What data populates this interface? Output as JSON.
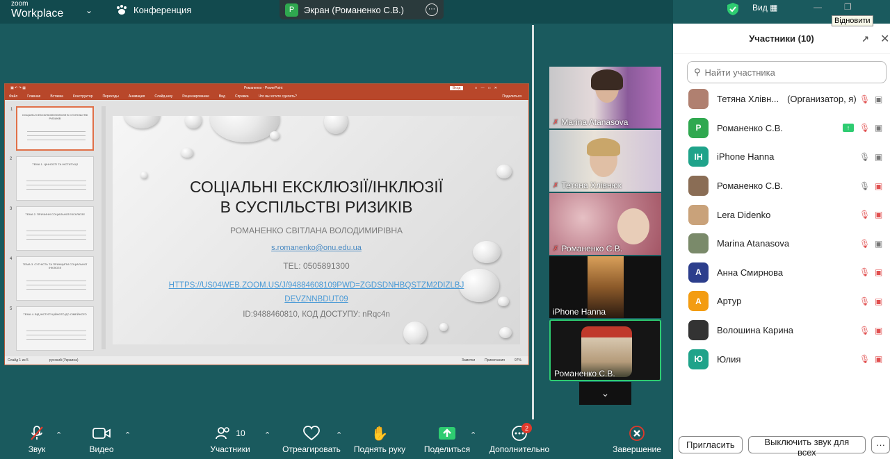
{
  "app": {
    "brand_top": "zoom",
    "brand_bottom": "Workplace",
    "meeting_label": "Конференция"
  },
  "screen_share": {
    "badge": "P",
    "label": "Экран (Романенко С.В.)"
  },
  "header_right": {
    "view_label": "Вид",
    "tooltip": "Відновити"
  },
  "slide": {
    "window_title": "Романенко - PowerPoint",
    "menu": [
      "Файл",
      "Главная",
      "Вставка",
      "Конструктор",
      "Переходы",
      "Анимация",
      "Слайд-шоу",
      "Рецензирование",
      "Вид",
      "Справка",
      "Что вы хотите сделать?"
    ],
    "share_btn": "Поделиться",
    "login_btn": "Вход",
    "title_line1": "СОЦІАЛЬНІ ЕКСКЛЮЗІЇ/ІНКЛЮЗІЇ",
    "title_line2": "В СУСПІЛЬСТВІ РИЗИКІВ",
    "author": "РОМАНЕНКО СВІТЛАНА ВОЛОДИМИРІВНА",
    "email": "s.romanenko@onu.edu.ua",
    "tel": "TEL: 0505891300",
    "url": "HTTPS://US04WEB.ZOOM.US/J/94884608109PWD=ZGDSDNHBQSTZM2DIZLBJDEVZNNBDUT09",
    "meeting_id": "ID:9488460810, КОД ДОСТУПУ: nRqc4n",
    "thumbs": [
      {
        "num": "1",
        "text": "СОЦІАЛЬНІ ЕКСКЛЮЗІЇ/ІНКЛЮЗІЇ В СУСПІЛЬСТВІ РИЗИКІВ"
      },
      {
        "num": "2",
        "text": "ТЕМА 1. ЦІННОСТІ ТА ІНСТИТУЦІЇ"
      },
      {
        "num": "3",
        "text": "ТЕМА 2. ПРИЧИНИ СОЦІАЛЬНОЇ ЕКСКЛЮЗІЇ"
      },
      {
        "num": "4",
        "text": "ТЕМА 3. СУТНІСТЬ ТА ПРИНЦИПИ СОЦІАЛЬНОЇ ІНКЛЮЗІЇ"
      },
      {
        "num": "5",
        "text": "ТЕМА 4. ВІД ІНСТИТУЦІЙНОГО ДО СІМЕЙНОГО"
      }
    ],
    "status_left": "Слайд 1 из 5",
    "status_lang": "русский (Украина)",
    "status_notes": "Заметки",
    "status_comments": "Примечания",
    "status_zoom": "97%"
  },
  "video_tiles": [
    {
      "name": "Marina Atanasova"
    },
    {
      "name": "Тетяна Хлівнюк"
    },
    {
      "name": "Романенко С.В."
    },
    {
      "name": "iPhone Hanna"
    },
    {
      "name": "Романенко С.В."
    }
  ],
  "participants": {
    "header": "Участники (10)",
    "search_placeholder": "Найти участника",
    "list": [
      {
        "initials": "",
        "name": "Тетяна Хлівн...",
        "role": "(Организатор, я)",
        "color": "#b08070"
      },
      {
        "initials": "P",
        "name": "Романенко С.В.",
        "role": "",
        "color": "#2fa84f"
      },
      {
        "initials": "IH",
        "name": "iPhone Hanna",
        "role": "",
        "color": "#1fa38a"
      },
      {
        "initials": "",
        "name": "Романенко С.В.",
        "role": "",
        "color": "#8a6d55"
      },
      {
        "initials": "",
        "name": "Lera Didenko",
        "role": "",
        "color": "#c9a27a"
      },
      {
        "initials": "",
        "name": "Marina Atanasova",
        "role": "",
        "color": "#7a8a6a"
      },
      {
        "initials": "А",
        "name": "Анна Смирнова",
        "role": "",
        "color": "#2c3e8c"
      },
      {
        "initials": "А",
        "name": "Артур",
        "role": "",
        "color": "#f39c12"
      },
      {
        "initials": "",
        "name": "Волошина Карина",
        "role": "",
        "color": "#333333"
      },
      {
        "initials": "Ю",
        "name": "Юлия",
        "role": "",
        "color": "#1fa38a"
      }
    ],
    "invite_btn": "Пригласить",
    "mute_all_btn": "Выключить звук для всех",
    "more_btn": "···"
  },
  "toolbar": {
    "audio": "Звук",
    "video": "Видео",
    "participants": "Участники",
    "participants_count": "10",
    "react": "Отреагировать",
    "raise_hand": "Поднять руку",
    "share": "Поделиться",
    "more": "Дополнительно",
    "more_badge": "2",
    "end": "Завершение"
  }
}
